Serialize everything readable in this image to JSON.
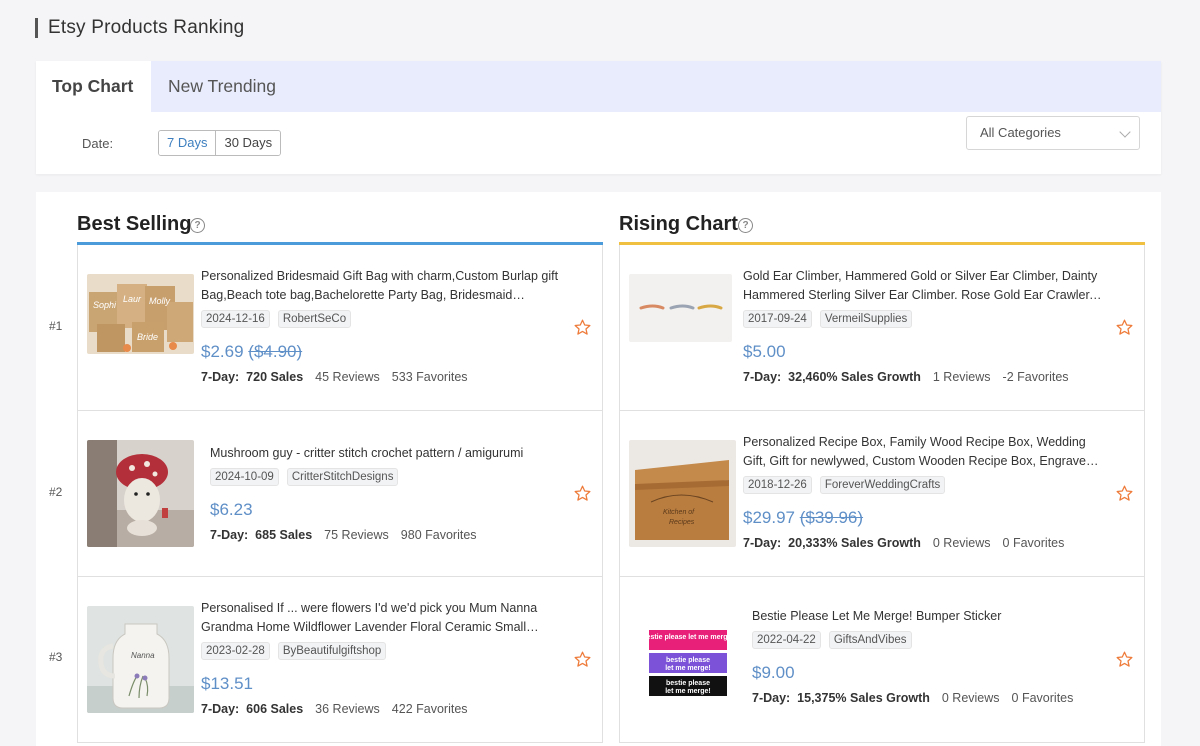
{
  "page": {
    "title": "Etsy Products Ranking"
  },
  "tabs": [
    {
      "label": "Top Chart",
      "active": true
    },
    {
      "label": "New Trending",
      "active": false
    }
  ],
  "filters": {
    "date_label": "Date:",
    "date_options": [
      "7 Days",
      "30 Days"
    ],
    "selected_date": "7 Days",
    "category": "All Categories"
  },
  "ranks": [
    "#1",
    "#2",
    "#3"
  ],
  "best_selling": {
    "title": "Best Selling",
    "accent": "#4b9ad9",
    "items": [
      {
        "title": "Personalized Bridesmaid Gift Bag with charm,Custom Burlap gift Bag,Beach tote bag,Bachelorette Party Bag, Bridesmaid Proposal...",
        "date": "2024-12-16",
        "shop": "RobertSeCo",
        "price": "$2.69",
        "original_price": "($4.90)",
        "stat_prefix": "7-Day:",
        "sales": "720 Sales",
        "reviews": "45 Reviews",
        "favorites": "533 Favorites"
      },
      {
        "title": "Mushroom guy - critter stitch crochet pattern / amigurumi",
        "date": "2024-10-09",
        "shop": "CritterStitchDesigns",
        "price": "$6.23",
        "original_price": "",
        "stat_prefix": "7-Day:",
        "sales": "685 Sales",
        "reviews": "75 Reviews",
        "favorites": "980 Favorites"
      },
      {
        "title": "Personalised If ... were flowers I'd we'd pick you Mum Nanna Grandma Home Wildflower Lavender Floral Ceramic Small Vase...",
        "date": "2023-02-28",
        "shop": "ByBeautifulgiftshop",
        "price": "$13.51",
        "original_price": "",
        "stat_prefix": "7-Day:",
        "sales": "606 Sales",
        "reviews": "36 Reviews",
        "favorites": "422 Favorites"
      }
    ]
  },
  "rising_chart": {
    "title": "Rising Chart",
    "accent": "#f0c040",
    "items": [
      {
        "title": "Gold Ear Climber, Hammered Gold or Silver Ear Climber, Dainty Hammered Sterling Silver Ear Climber. Rose Gold Ear Crawler, B...",
        "date": "2017-09-24",
        "shop": "VermeilSupplies",
        "price": "$5.00",
        "original_price": "",
        "stat_prefix": "7-Day:",
        "sales": "32,460% Sales Growth",
        "reviews": "1 Reviews",
        "favorites": "-2 Favorites"
      },
      {
        "title": "Personalized Recipe Box, Family Wood Recipe Box, Wedding Gift, Gift for newlywed, Custom Wooden Recipe Box, Engraved Recipe...",
        "date": "2018-12-26",
        "shop": "ForeverWeddingCrafts",
        "price": "$29.97",
        "original_price": "($39.96)",
        "stat_prefix": "7-Day:",
        "sales": "20,333% Sales Growth",
        "reviews": "0 Reviews",
        "favorites": "0 Favorites"
      },
      {
        "title": "Bestie Please Let Me Merge! Bumper Sticker",
        "date": "2022-04-22",
        "shop": "GiftsAndVibes",
        "price": "$9.00",
        "original_price": "",
        "stat_prefix": "7-Day:",
        "sales": "15,375% Sales Growth",
        "reviews": "0 Reviews",
        "favorites": "0 Favorites",
        "sticker_text": "bestie please let me merge!"
      }
    ]
  },
  "help_glyph": "?"
}
